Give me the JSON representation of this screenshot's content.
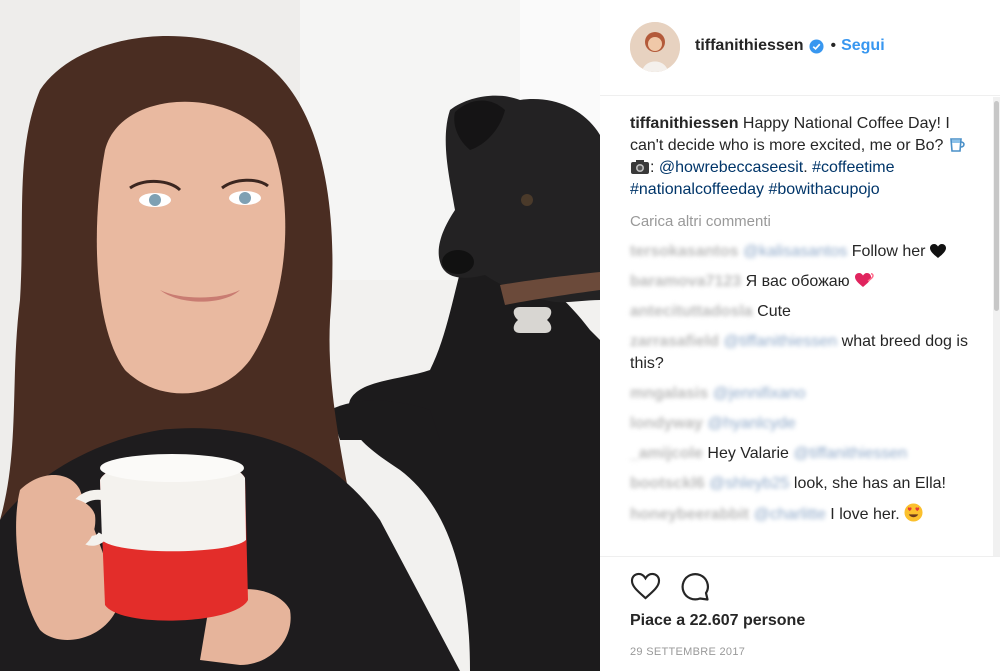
{
  "post": {
    "username": "tiffanithiessen",
    "follow_label": "Segui",
    "dot": "•",
    "caption_user": "tiffanithiessen",
    "caption_text_1": " Happy National Coffee Day! I can't decide who is more excited, me or Bo? ",
    "caption_text_2": ": ",
    "caption_mention": "@howrebeccaseesit",
    "caption_text_3": ". ",
    "hashtags": [
      "#coffeetime",
      "#nationalcoffeeday",
      "#bowithacupojo"
    ],
    "load_more": "Carica altri commenti",
    "likes": "Piace a 22.607 persone",
    "date": "29 SETTEMBRE 2017"
  },
  "comments": [
    {
      "user": "tersokasantos",
      "mention": "@kalisasantos",
      "text": " Follow her "
    },
    {
      "user": "baramova7123",
      "mention": "",
      "text": " Я вас обожаю "
    },
    {
      "user": "antecituttadosla",
      "mention": "",
      "text": " Cute"
    },
    {
      "user": "zarrasafield",
      "mention": "@tiffanithiessen",
      "text": " what breed dog is this?"
    },
    {
      "user": "mngalasis",
      "mention": "@jennifixano",
      "text": ""
    },
    {
      "user": "londyway",
      "mention": "@hyanlcyde",
      "text": ""
    },
    {
      "user": "_amijcole",
      "mention": "",
      "text": " Hey Valarie ",
      "mention_after": "@tiffanithiessen"
    },
    {
      "user": "bootsckl6",
      "mention": "@shleyb25",
      "text": " look, she has an Ella!"
    },
    {
      "user": "honeybeerabbit",
      "mention": "@charlitte",
      "text": " I love her. "
    }
  ]
}
